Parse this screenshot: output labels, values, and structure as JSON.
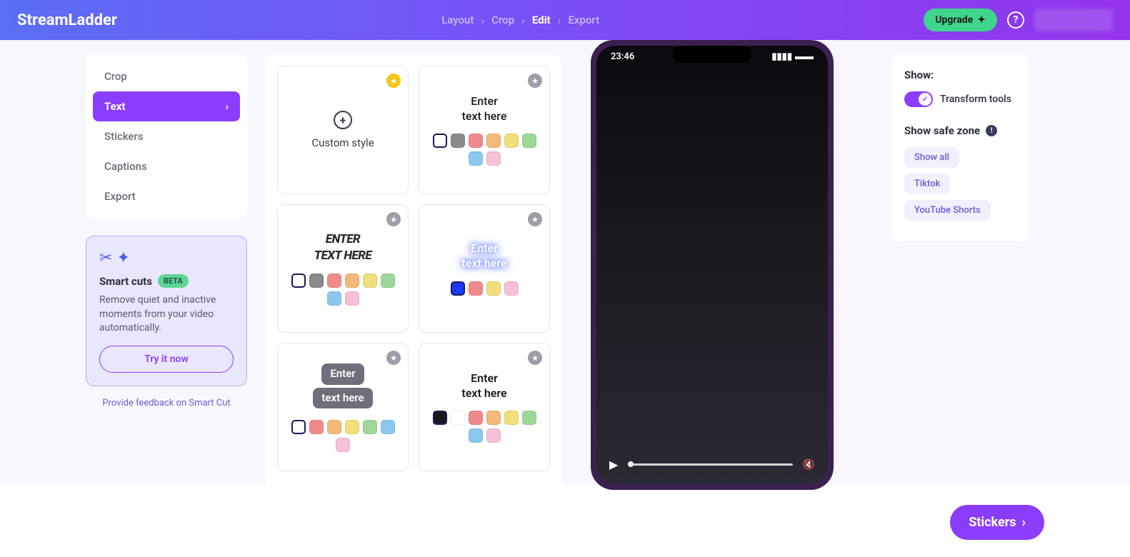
{
  "header": {
    "logo": "StreamLadder",
    "breadcrumb": [
      "Layout",
      "Crop",
      "Edit",
      "Export"
    ],
    "breadcrumb_active_index": 2,
    "upgrade_label": "Upgrade"
  },
  "sidebar": {
    "items": [
      "Crop",
      "Text",
      "Stickers",
      "Captions",
      "Export"
    ],
    "active_index": 1
  },
  "smartcuts": {
    "title": "Smart cuts",
    "beta": "BETA",
    "desc": "Remove quiet and inactive moments from your video automatically.",
    "try_label": "Try it now",
    "feedback": "Provide feedback on Smart Cut"
  },
  "styles": {
    "custom_label": "Custom style",
    "sample_text_line1": "Enter",
    "sample_text_line2": "text here",
    "palettes": {
      "seven": [
        "#ffffff",
        "#8a8a8a",
        "#f08a8a",
        "#f5b87a",
        "#f0df7a",
        "#9dd89a",
        "#8ac8f0",
        "#f5c0d8"
      ],
      "four": [
        "#1a3aff",
        "#f08a8a",
        "#f0df7a",
        "#f5c0d8"
      ],
      "six": [
        "#ffffff",
        "#f08a8a",
        "#f5b87a",
        "#f0df7a",
        "#9dd89a",
        "#8ac8f0",
        "#f5c0d8"
      ],
      "eight": [
        "#1a1a1a",
        "#ffffff",
        "#f08a8a",
        "#f5b87a",
        "#f0df7a",
        "#9dd89a",
        "#8ac8f0",
        "#f5c0d8"
      ]
    }
  },
  "phone": {
    "time": "23:46"
  },
  "right": {
    "show_title": "Show:",
    "transform_label": "Transform tools",
    "safezone_title": "Show safe zone",
    "safezone_options": [
      "Show all",
      "Tiktok",
      "YouTube Shorts"
    ]
  },
  "next_button": "Stickers"
}
